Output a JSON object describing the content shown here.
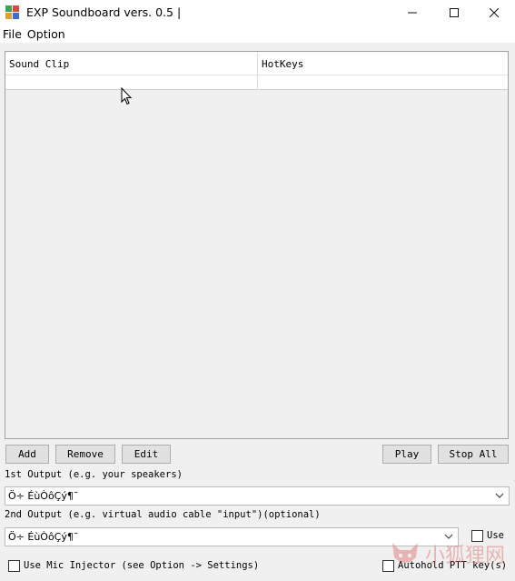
{
  "window": {
    "title": "EXP Soundboard vers. 0.5 |",
    "minimize_glyph": "—",
    "maximize_glyph": "☐",
    "close_glyph": "✕"
  },
  "menu": [
    "File",
    "Option"
  ],
  "table": {
    "columns": [
      "Sound Clip",
      "HotKeys"
    ]
  },
  "buttons": {
    "add": "Add",
    "remove": "Remove",
    "edit": "Edit",
    "play": "Play",
    "stop_all": "Stop All"
  },
  "output1": {
    "label": "1st Output (e.g. your speakers)",
    "value": "Ö÷ ÉùÒôÇý¶¯"
  },
  "output2": {
    "label": "2nd Output (e.g. virtual audio cable \"input\")(optional)",
    "value": "Ö÷ ÉùÒôÇý¶¯",
    "use_label": "Use"
  },
  "options": {
    "mic_injector_label": "Use Mic Injector (see Option -> Settings)",
    "autohold_label": "Autohold PTT key(s)"
  },
  "watermark": {
    "text": "小狐狸网"
  },
  "colors": {
    "accent_red": "#e06a6a"
  }
}
